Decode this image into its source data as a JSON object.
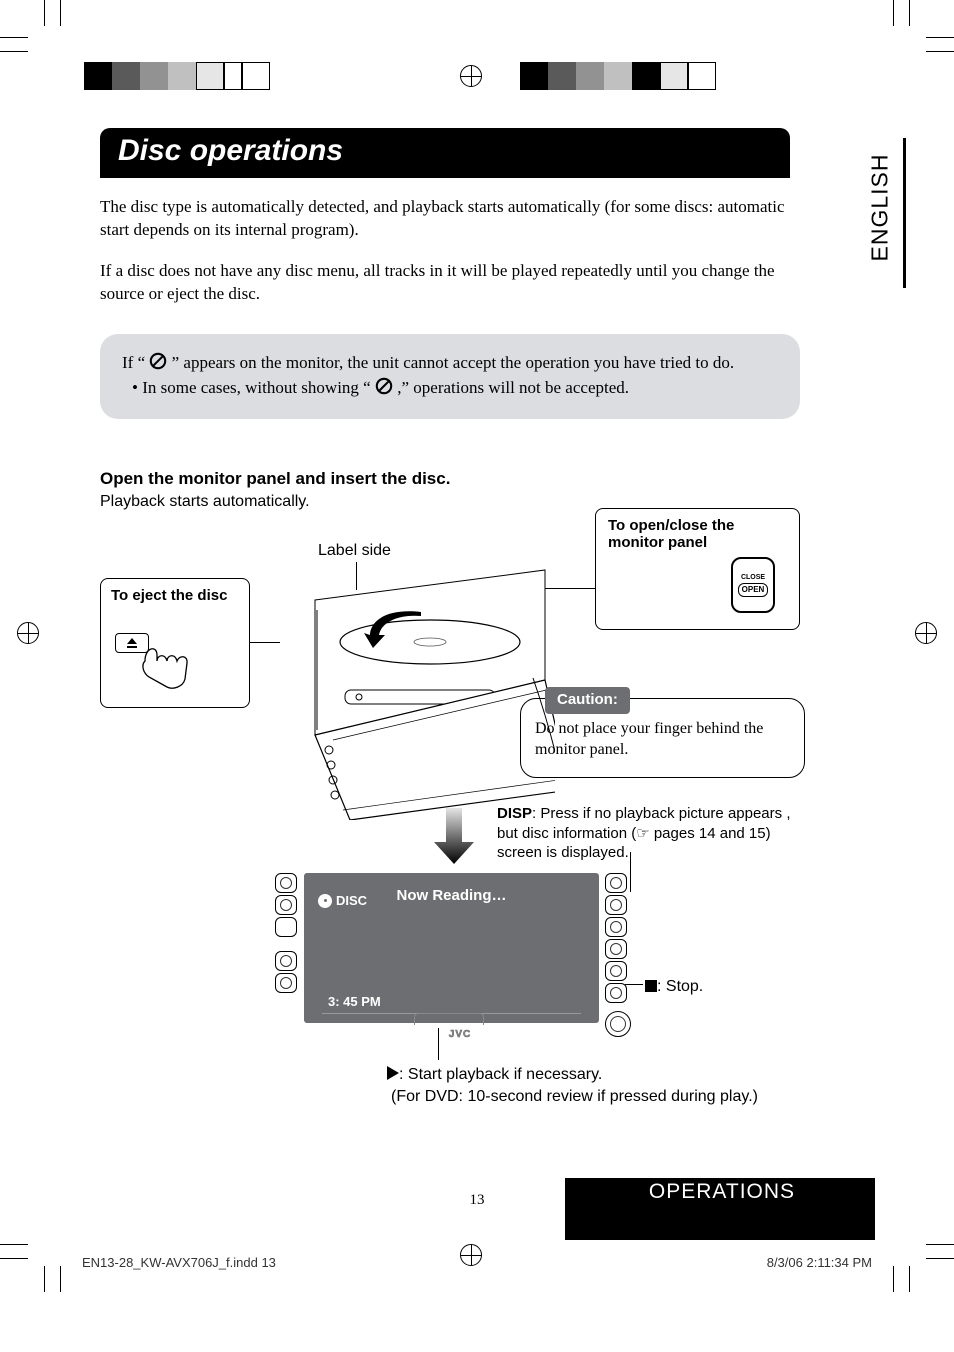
{
  "meta": {
    "page_number": "13",
    "footer_left": "EN13-28_KW-AVX706J_f.indd   13",
    "footer_right": "8/3/06   2:11:34 PM"
  },
  "language_tab": "ENGLISH",
  "title": "Disc operations",
  "para1": "The disc type is automatically detected, and playback starts automatically (for some discs: automatic start depends on its internal program).",
  "para2": "If a disc does not have any disc menu, all tracks in it will be played repeatedly until you change the source or eject the disc.",
  "tint": {
    "line1_pre": "If “",
    "line1_post": "” appears on the monitor, the unit cannot accept the operation you have tried to do.",
    "bullet_pre": "• In some cases, without showing “",
    "bullet_post": ",” operations will not be accepted."
  },
  "section": {
    "heading": "Open the monitor panel and insert the disc.",
    "sub": "Playback starts automatically."
  },
  "labels": {
    "label_side": "Label side",
    "eject_title": "To eject the disc",
    "open_title": "To open/close the monitor panel",
    "open_btn_top": "CLOSE",
    "open_btn_main": "OPEN",
    "caution_badge": "Caution:",
    "caution_text": "Do not place your finger behind the monitor panel.",
    "disp_bold": "DISP",
    "disp_text": ": Press if no playback picture appears , but disc information (☞ pages 14 and 15) screen is displayed.",
    "stop_label": ": Stop.",
    "play_line1": ": Start playback if necessary.",
    "play_line2": "(For DVD: 10-second review if pressed during play.)",
    "jvc": "JVC"
  },
  "screen": {
    "disc": "DISC",
    "now_reading": "Now Reading…",
    "time": "3: 45 PM"
  },
  "footer_bar": "OPERATIONS"
}
